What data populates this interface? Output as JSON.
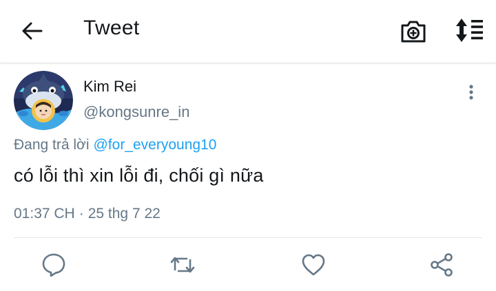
{
  "header": {
    "title": "Tweet",
    "icons": [
      "back-arrow-icon",
      "camera-icon",
      "sort-icon"
    ]
  },
  "tweet": {
    "author_name": "Kim Rei",
    "author_handle": "@kongsunre_in",
    "replying_prefix": "Đang trả lời",
    "replying_to": "@for_everyoung10",
    "text": "có lỗi thì xin lỗi đi, chối gì nữa",
    "time": "01:37 CH",
    "separator": "·",
    "date": "25 thg 7 22"
  },
  "actions": [
    "reply-icon",
    "retweet-icon",
    "like-icon",
    "share-icon"
  ],
  "colors": {
    "text": "#14171a",
    "secondary": "#657786",
    "link": "#1da1f2",
    "divider": "#e1e8ed"
  }
}
